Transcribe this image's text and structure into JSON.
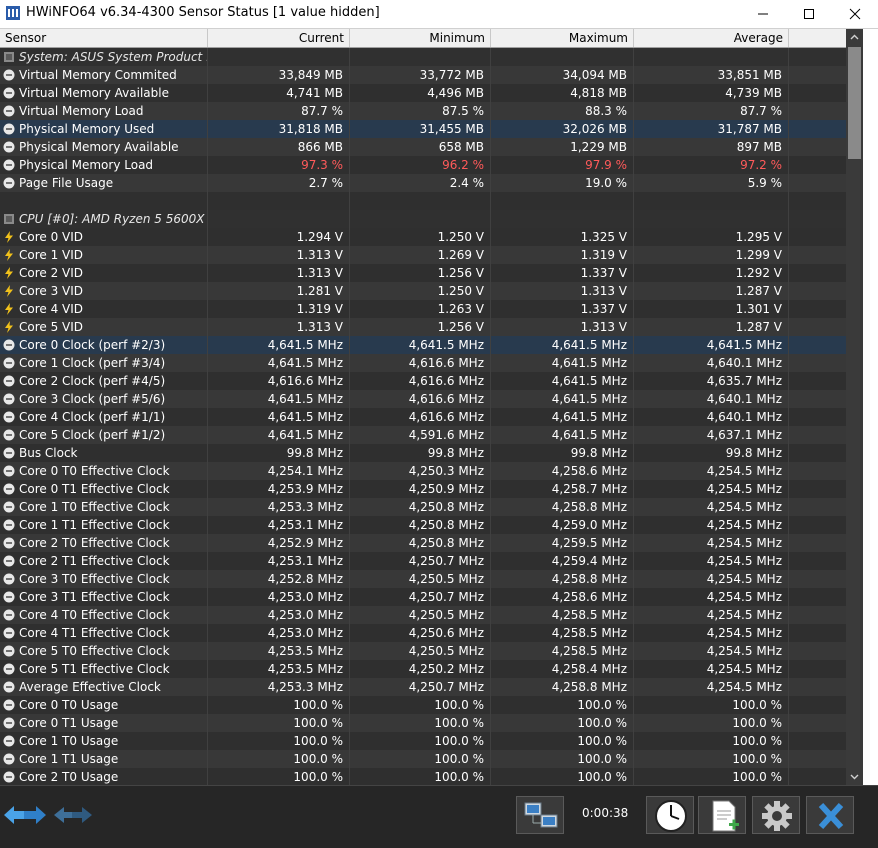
{
  "window": {
    "title": "HWiNFO64 v6.34-4300 Sensor Status [1 value hidden]"
  },
  "columns": {
    "sensor": "Sensor",
    "current": "Current",
    "minimum": "Minimum",
    "maximum": "Maximum",
    "average": "Average"
  },
  "rows": [
    {
      "type": "group",
      "name": "System: ASUS System Product ...",
      "icon": "chip-icon"
    },
    {
      "name": "Virtual Memory Commited",
      "icon": "gauge-icon",
      "vals": [
        "33,849 MB",
        "33,772 MB",
        "34,094 MB",
        "33,851 MB"
      ]
    },
    {
      "name": "Virtual Memory Available",
      "icon": "gauge-icon",
      "vals": [
        "4,741 MB",
        "4,496 MB",
        "4,818 MB",
        "4,739 MB"
      ]
    },
    {
      "name": "Virtual Memory Load",
      "icon": "gauge-icon",
      "vals": [
        "87.7 %",
        "87.5 %",
        "88.3 %",
        "87.7 %"
      ]
    },
    {
      "name": "Physical Memory Used",
      "icon": "gauge-icon",
      "vals": [
        "31,818 MB",
        "31,455 MB",
        "32,026 MB",
        "31,787 MB"
      ],
      "selected": true
    },
    {
      "name": "Physical Memory Available",
      "icon": "gauge-icon",
      "vals": [
        "866 MB",
        "658 MB",
        "1,229 MB",
        "897 MB"
      ]
    },
    {
      "name": "Physical Memory Load",
      "icon": "gauge-icon",
      "vals": [
        "97.3 %",
        "96.2 %",
        "97.9 %",
        "97.2 %"
      ],
      "alert": true
    },
    {
      "name": "Page File Usage",
      "icon": "gauge-icon",
      "vals": [
        "2.7 %",
        "2.4 %",
        "19.0 %",
        "5.9 %"
      ]
    },
    {
      "type": "blank"
    },
    {
      "type": "group",
      "name": "CPU [#0]: AMD Ryzen 5 5600X",
      "icon": "chip-icon"
    },
    {
      "name": "Core 0 VID",
      "icon": "bolt-icon",
      "vals": [
        "1.294 V",
        "1.250 V",
        "1.325 V",
        "1.295 V"
      ]
    },
    {
      "name": "Core 1 VID",
      "icon": "bolt-icon",
      "vals": [
        "1.313 V",
        "1.269 V",
        "1.319 V",
        "1.299 V"
      ]
    },
    {
      "name": "Core 2 VID",
      "icon": "bolt-icon",
      "vals": [
        "1.313 V",
        "1.256 V",
        "1.337 V",
        "1.292 V"
      ]
    },
    {
      "name": "Core 3 VID",
      "icon": "bolt-icon",
      "vals": [
        "1.281 V",
        "1.250 V",
        "1.313 V",
        "1.287 V"
      ]
    },
    {
      "name": "Core 4 VID",
      "icon": "bolt-icon",
      "vals": [
        "1.319 V",
        "1.263 V",
        "1.337 V",
        "1.301 V"
      ]
    },
    {
      "name": "Core 5 VID",
      "icon": "bolt-icon",
      "vals": [
        "1.313 V",
        "1.256 V",
        "1.313 V",
        "1.287 V"
      ]
    },
    {
      "name": "Core 0 Clock (perf #2/3)",
      "icon": "gauge-icon",
      "vals": [
        "4,641.5 MHz",
        "4,641.5 MHz",
        "4,641.5 MHz",
        "4,641.5 MHz"
      ],
      "selected": true
    },
    {
      "name": "Core 1 Clock (perf #3/4)",
      "icon": "gauge-icon",
      "vals": [
        "4,641.5 MHz",
        "4,616.6 MHz",
        "4,641.5 MHz",
        "4,640.1 MHz"
      ]
    },
    {
      "name": "Core 2 Clock (perf #4/5)",
      "icon": "gauge-icon",
      "vals": [
        "4,616.6 MHz",
        "4,616.6 MHz",
        "4,641.5 MHz",
        "4,635.7 MHz"
      ]
    },
    {
      "name": "Core 3 Clock (perf #5/6)",
      "icon": "gauge-icon",
      "vals": [
        "4,641.5 MHz",
        "4,616.6 MHz",
        "4,641.5 MHz",
        "4,640.1 MHz"
      ]
    },
    {
      "name": "Core 4 Clock (perf #1/1)",
      "icon": "gauge-icon",
      "vals": [
        "4,641.5 MHz",
        "4,616.6 MHz",
        "4,641.5 MHz",
        "4,640.1 MHz"
      ]
    },
    {
      "name": "Core 5 Clock (perf #1/2)",
      "icon": "gauge-icon",
      "vals": [
        "4,641.5 MHz",
        "4,591.6 MHz",
        "4,641.5 MHz",
        "4,637.1 MHz"
      ]
    },
    {
      "name": "Bus Clock",
      "icon": "gauge-icon",
      "vals": [
        "99.8 MHz",
        "99.8 MHz",
        "99.8 MHz",
        "99.8 MHz"
      ]
    },
    {
      "name": "Core 0 T0 Effective Clock",
      "icon": "gauge-icon",
      "vals": [
        "4,254.1 MHz",
        "4,250.3 MHz",
        "4,258.6 MHz",
        "4,254.5 MHz"
      ]
    },
    {
      "name": "Core 0 T1 Effective Clock",
      "icon": "gauge-icon",
      "vals": [
        "4,253.9 MHz",
        "4,250.9 MHz",
        "4,258.7 MHz",
        "4,254.5 MHz"
      ]
    },
    {
      "name": "Core 1 T0 Effective Clock",
      "icon": "gauge-icon",
      "vals": [
        "4,253.3 MHz",
        "4,250.8 MHz",
        "4,258.8 MHz",
        "4,254.5 MHz"
      ]
    },
    {
      "name": "Core 1 T1 Effective Clock",
      "icon": "gauge-icon",
      "vals": [
        "4,253.1 MHz",
        "4,250.8 MHz",
        "4,259.0 MHz",
        "4,254.5 MHz"
      ]
    },
    {
      "name": "Core 2 T0 Effective Clock",
      "icon": "gauge-icon",
      "vals": [
        "4,252.9 MHz",
        "4,250.8 MHz",
        "4,259.5 MHz",
        "4,254.5 MHz"
      ]
    },
    {
      "name": "Core 2 T1 Effective Clock",
      "icon": "gauge-icon",
      "vals": [
        "4,253.1 MHz",
        "4,250.7 MHz",
        "4,259.4 MHz",
        "4,254.5 MHz"
      ]
    },
    {
      "name": "Core 3 T0 Effective Clock",
      "icon": "gauge-icon",
      "vals": [
        "4,252.8 MHz",
        "4,250.5 MHz",
        "4,258.8 MHz",
        "4,254.5 MHz"
      ]
    },
    {
      "name": "Core 3 T1 Effective Clock",
      "icon": "gauge-icon",
      "vals": [
        "4,253.0 MHz",
        "4,250.7 MHz",
        "4,258.6 MHz",
        "4,254.5 MHz"
      ]
    },
    {
      "name": "Core 4 T0 Effective Clock",
      "icon": "gauge-icon",
      "vals": [
        "4,253.0 MHz",
        "4,250.5 MHz",
        "4,258.5 MHz",
        "4,254.5 MHz"
      ]
    },
    {
      "name": "Core 4 T1 Effective Clock",
      "icon": "gauge-icon",
      "vals": [
        "4,253.0 MHz",
        "4,250.6 MHz",
        "4,258.5 MHz",
        "4,254.5 MHz"
      ]
    },
    {
      "name": "Core 5 T0 Effective Clock",
      "icon": "gauge-icon",
      "vals": [
        "4,253.5 MHz",
        "4,250.5 MHz",
        "4,258.5 MHz",
        "4,254.5 MHz"
      ]
    },
    {
      "name": "Core 5 T1 Effective Clock",
      "icon": "gauge-icon",
      "vals": [
        "4,253.5 MHz",
        "4,250.2 MHz",
        "4,258.4 MHz",
        "4,254.5 MHz"
      ]
    },
    {
      "name": "Average Effective Clock",
      "icon": "gauge-icon",
      "vals": [
        "4,253.3 MHz",
        "4,250.7 MHz",
        "4,258.8 MHz",
        "4,254.5 MHz"
      ]
    },
    {
      "name": "Core 0 T0 Usage",
      "icon": "gauge-icon",
      "vals": [
        "100.0 %",
        "100.0 %",
        "100.0 %",
        "100.0 %"
      ]
    },
    {
      "name": "Core 0 T1 Usage",
      "icon": "gauge-icon",
      "vals": [
        "100.0 %",
        "100.0 %",
        "100.0 %",
        "100.0 %"
      ]
    },
    {
      "name": "Core 1 T0 Usage",
      "icon": "gauge-icon",
      "vals": [
        "100.0 %",
        "100.0 %",
        "100.0 %",
        "100.0 %"
      ]
    },
    {
      "name": "Core 1 T1 Usage",
      "icon": "gauge-icon",
      "vals": [
        "100.0 %",
        "100.0 %",
        "100.0 %",
        "100.0 %"
      ]
    },
    {
      "name": "Core 2 T0 Usage",
      "icon": "gauge-icon",
      "vals": [
        "100.0 %",
        "100.0 %",
        "100.0 %",
        "100.0 %"
      ]
    }
  ],
  "toolbar": {
    "timer": "0:00:38"
  },
  "colors": {
    "alert": "#ff5a5a",
    "selected_row": "#283a4e",
    "close_button": "#3a8fd8"
  }
}
